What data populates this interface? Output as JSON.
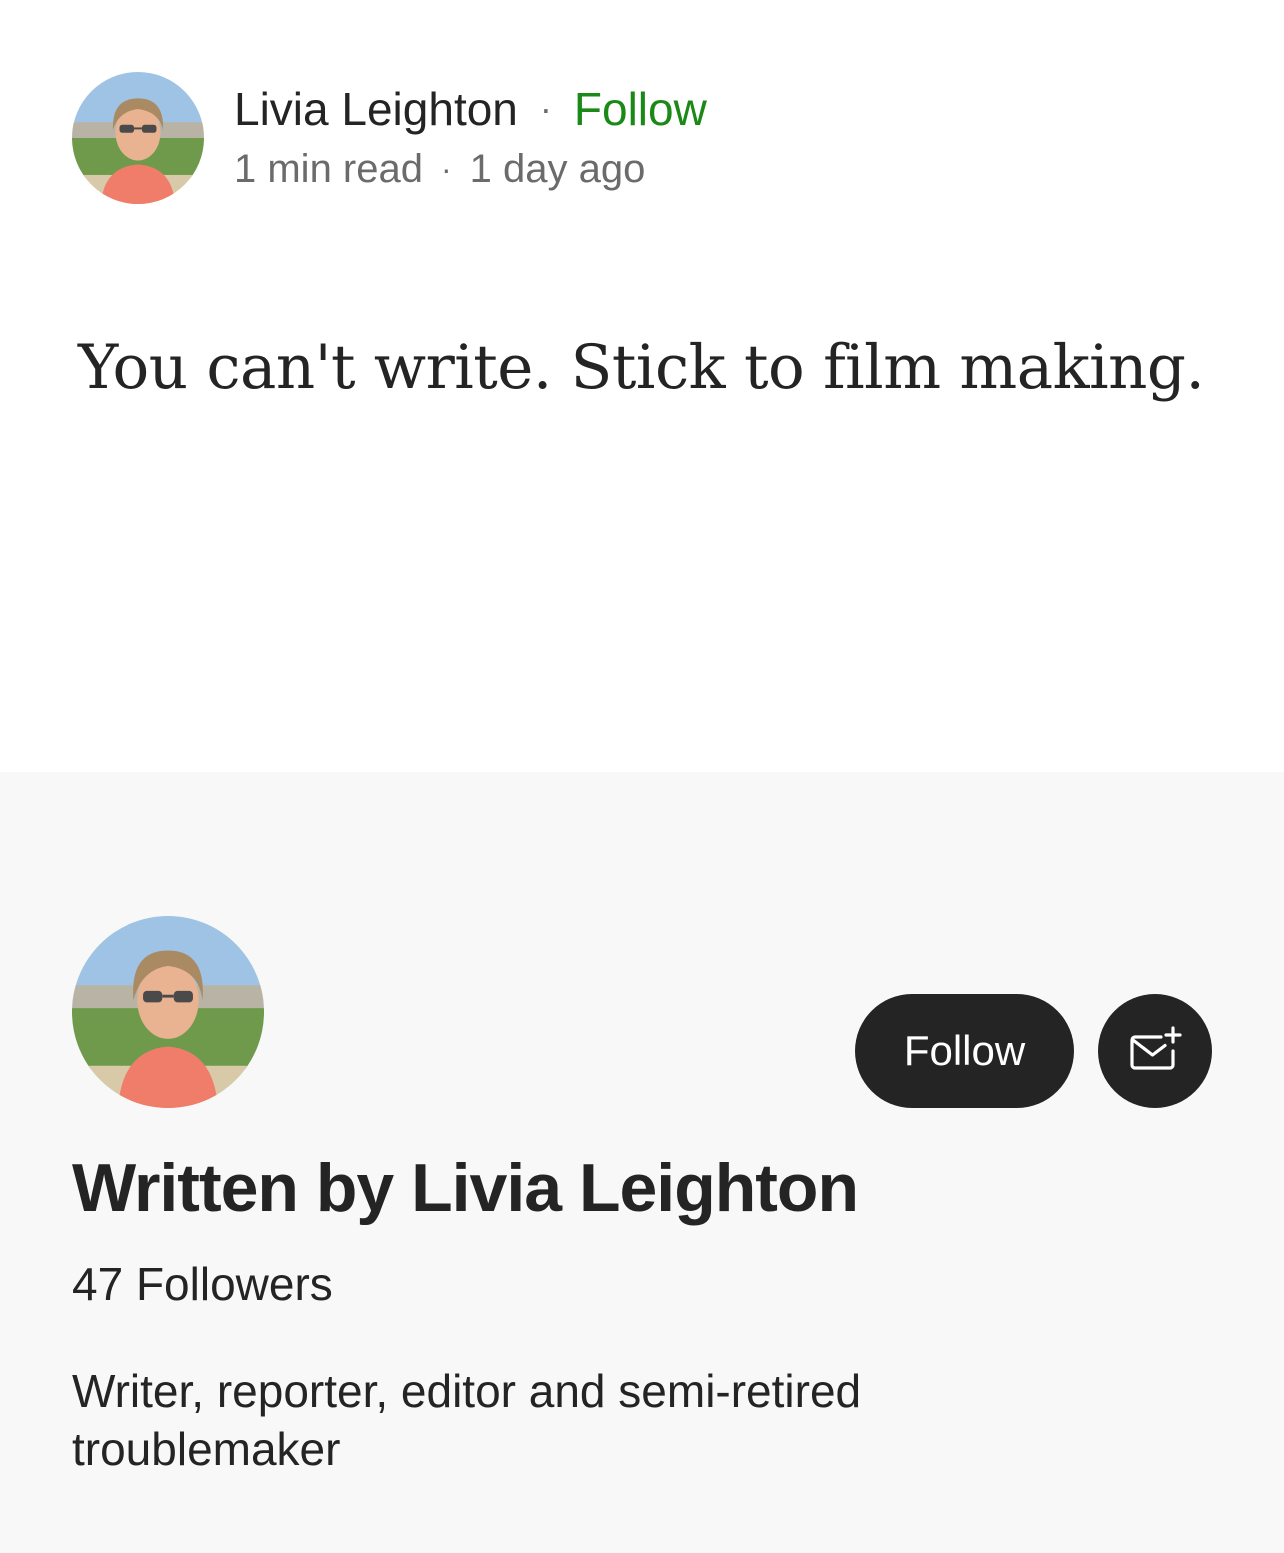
{
  "byline": {
    "author_name": "Livia Leighton",
    "separator": "·",
    "follow_label": "Follow",
    "read_time": "1 min read",
    "posted": "1 day ago"
  },
  "story": {
    "text": "You can't write. Stick to film making."
  },
  "author_card": {
    "follow_button_label": "Follow",
    "subscribe_icon": "mail-plus-icon",
    "written_by": "Written by Livia Leighton",
    "followers": "47 Followers",
    "bio": "Writer, reporter, editor and semi-retired troublemaker"
  },
  "colors": {
    "follow_link": "#1a8917",
    "text_primary": "#242424",
    "text_secondary": "#6b6b6b",
    "card_background": "#f8f8f8",
    "button_background": "#242424"
  }
}
